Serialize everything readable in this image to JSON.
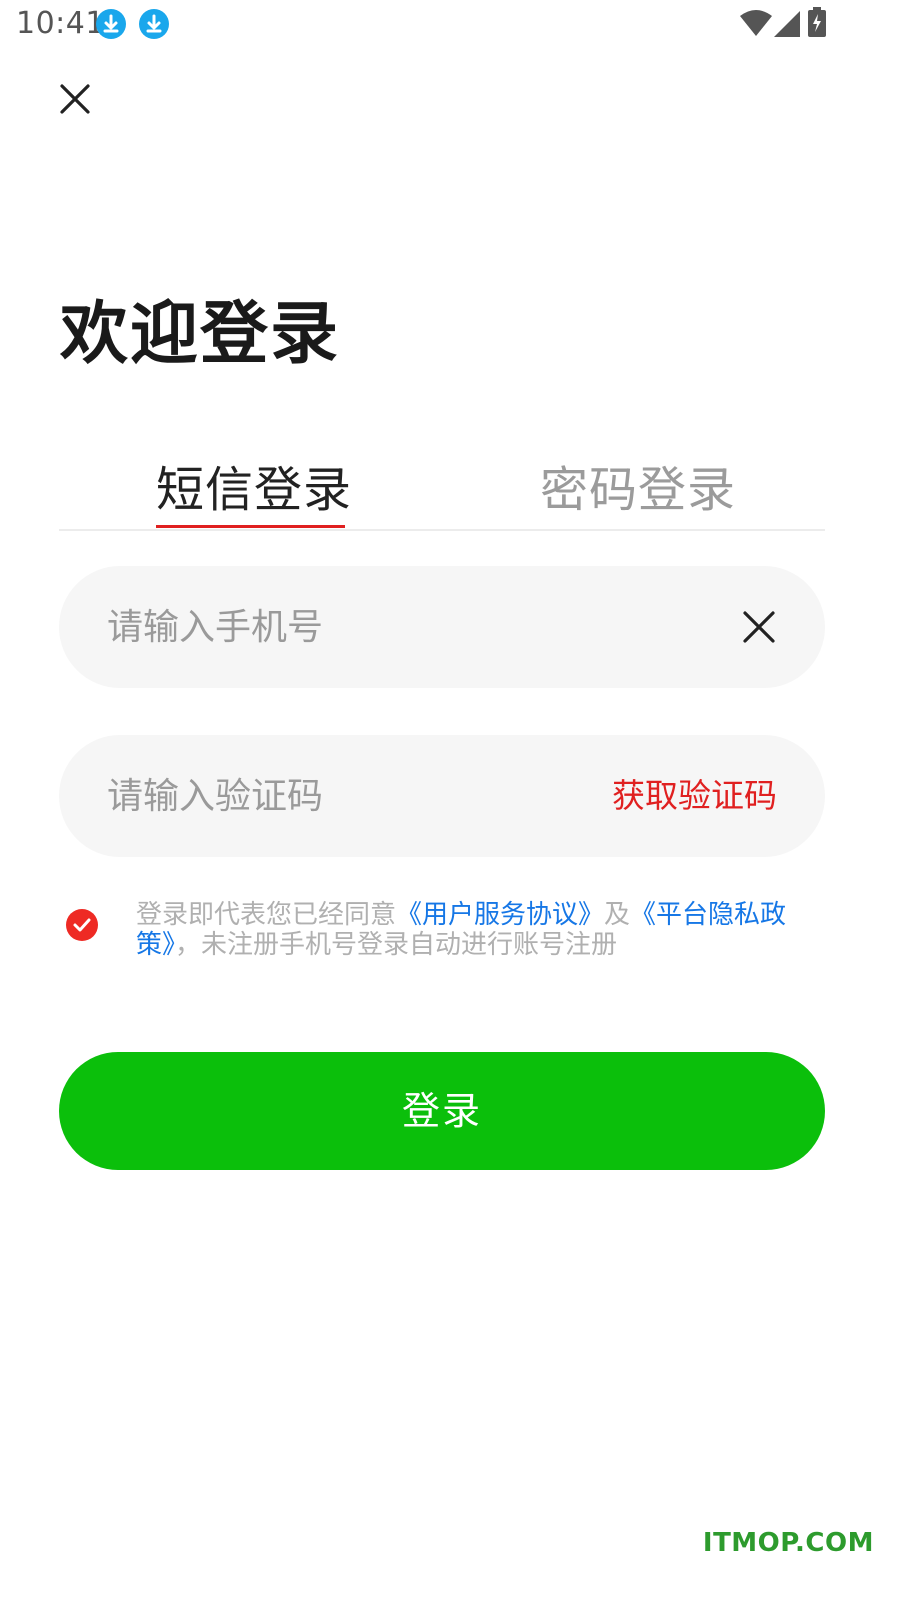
{
  "status_bar": {
    "time": "10:41",
    "notification_icons": [
      "download-icon",
      "download-icon"
    ],
    "system_icons": [
      "wifi-icon",
      "signal-icon",
      "battery-charging-icon"
    ]
  },
  "header": {
    "close_icon": "close-icon"
  },
  "page": {
    "title": "欢迎登录"
  },
  "tabs": [
    {
      "label": "短信登录",
      "active": true
    },
    {
      "label": "密码登录",
      "active": false
    }
  ],
  "form": {
    "phone": {
      "value": "",
      "placeholder": "请输入手机号",
      "clear_icon": "clear-icon"
    },
    "code": {
      "value": "",
      "placeholder": "请输入验证码",
      "get_code_label": "获取验证码"
    }
  },
  "agreement": {
    "checked": true,
    "text_prefix": "登录即代表您已经同意",
    "user_agreement_link": "《用户服务协议》",
    "conjunction": "及",
    "privacy_link": "《平台隐私政策》",
    "text_suffix": "，未注册手机号登录自动进行账号注册"
  },
  "login_button": {
    "label": "登录"
  },
  "watermark": "ITMOP.COM",
  "colors": {
    "accent_red": "#e02020",
    "login_green": "#0bbf0b",
    "link_blue": "#1677e6",
    "download_blue": "#1aa7ec"
  }
}
